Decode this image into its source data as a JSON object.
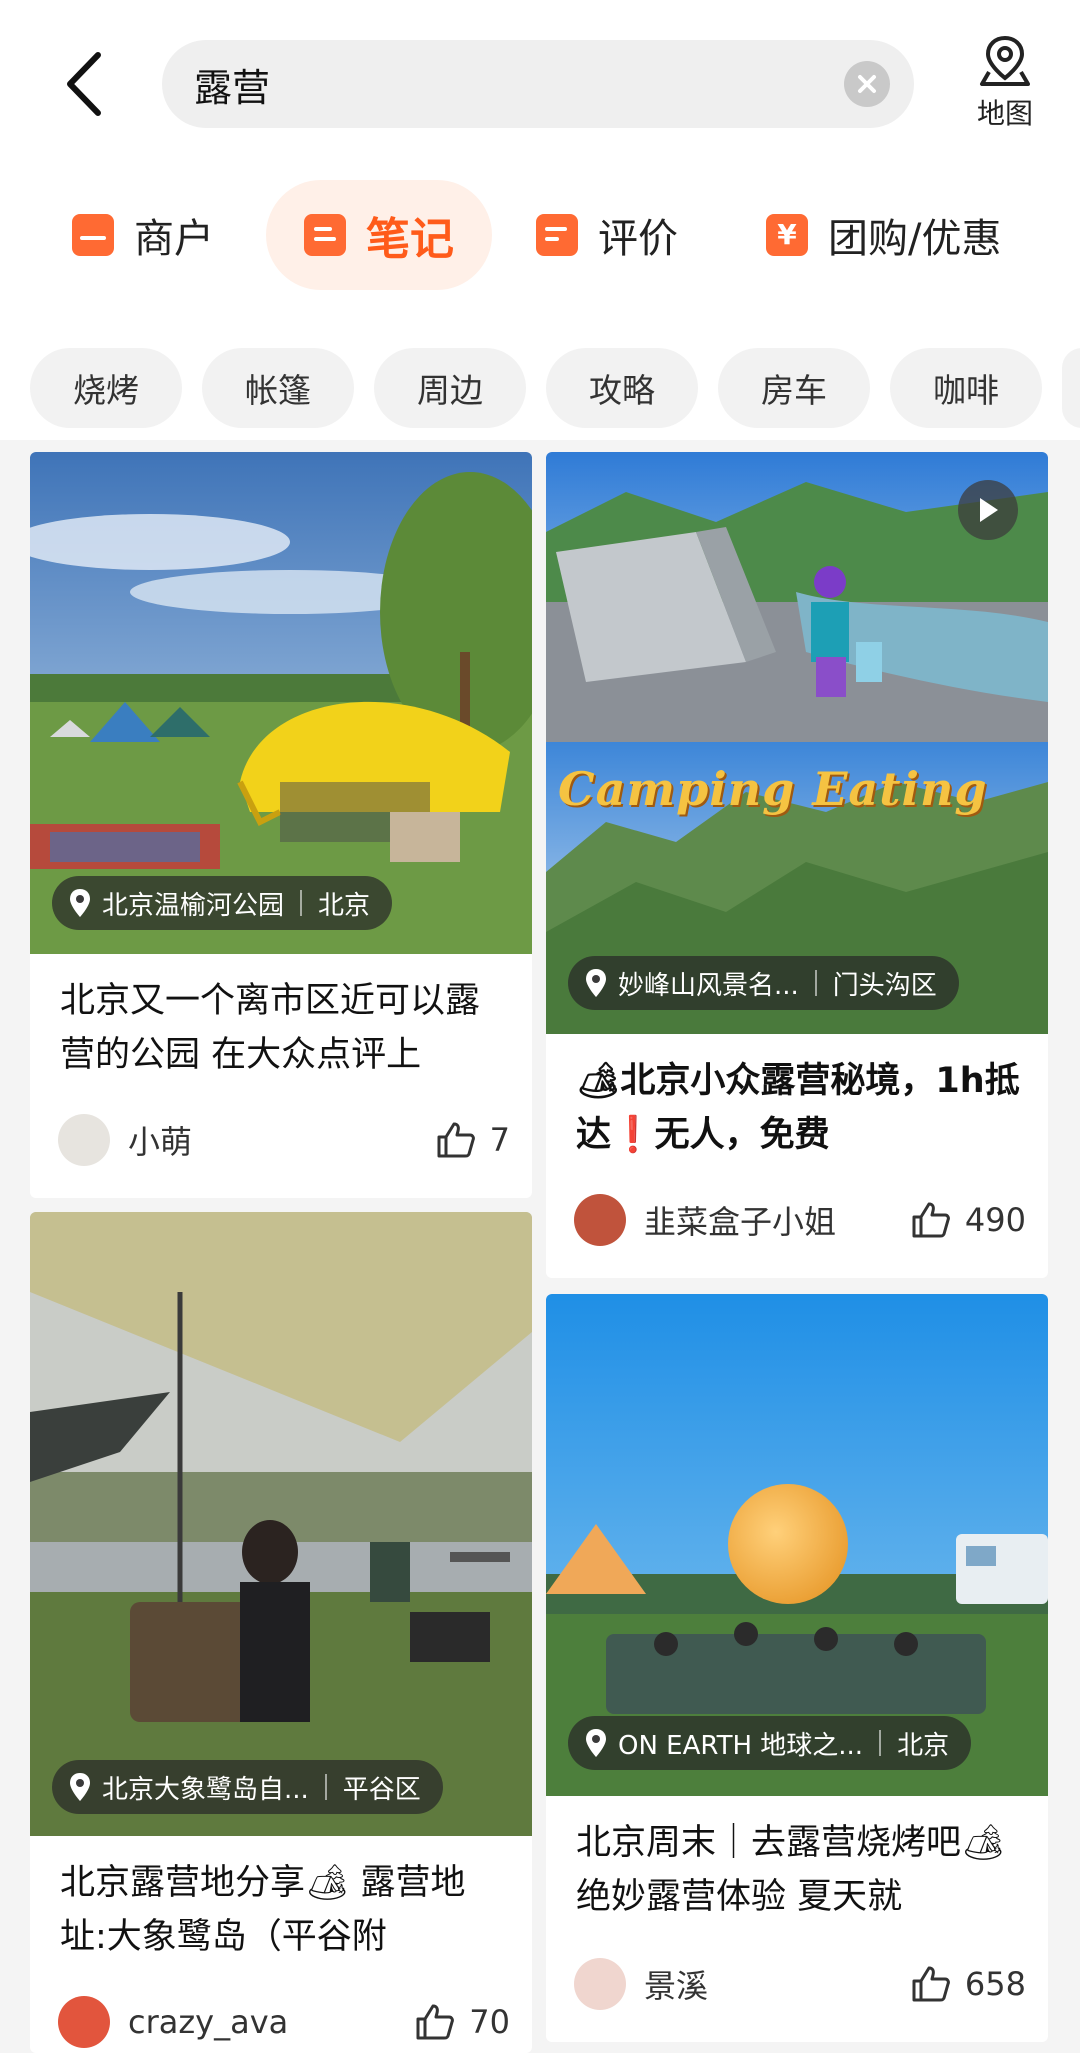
{
  "search": {
    "query": "露营"
  },
  "map": {
    "label": "地图"
  },
  "tabs": [
    {
      "label": "商户"
    },
    {
      "label": "笔记"
    },
    {
      "label": "评价"
    },
    {
      "label": "团购/优惠"
    }
  ],
  "chips": [
    "烧烤",
    "帐篷",
    "周边",
    "攻略",
    "房车",
    "咖啡"
  ],
  "cards": [
    {
      "location": "北京温榆河公园",
      "district": "北京",
      "title": "北京又一个离市区近可以露营的公园 在大众点评上",
      "author": "小萌",
      "likes": "7"
    },
    {
      "location": "妙峰山风景名...",
      "district": "门头沟区",
      "overlay_text": "Camping Eating",
      "title": "🏕北京小众露营秘境，1h抵达❗无人，免费",
      "author": "韭菜盒子小姐",
      "likes": "490"
    },
    {
      "location": "北京大象鹭岛自...",
      "district": "平谷区",
      "title": "北京露营地分享🏕 露营地址:大象鹭岛（平谷附",
      "author": "crazy_ava",
      "likes": "70"
    },
    {
      "location": "ON EARTH 地球之...",
      "district": "北京",
      "title": "北京周末｜去露营烧烤吧🏕绝妙露营体验 夏天就",
      "author": "景溪",
      "likes": "658"
    }
  ],
  "colors": {
    "accent": "#ff5b1a",
    "accent_bg": "#fff0e8"
  },
  "icons": [
    "back-arrow-icon",
    "clear-icon",
    "map-pin-icon",
    "shop-icon",
    "note-icon",
    "review-icon",
    "coupon-icon",
    "location-pin-icon",
    "thumbs-up-icon",
    "play-icon"
  ]
}
